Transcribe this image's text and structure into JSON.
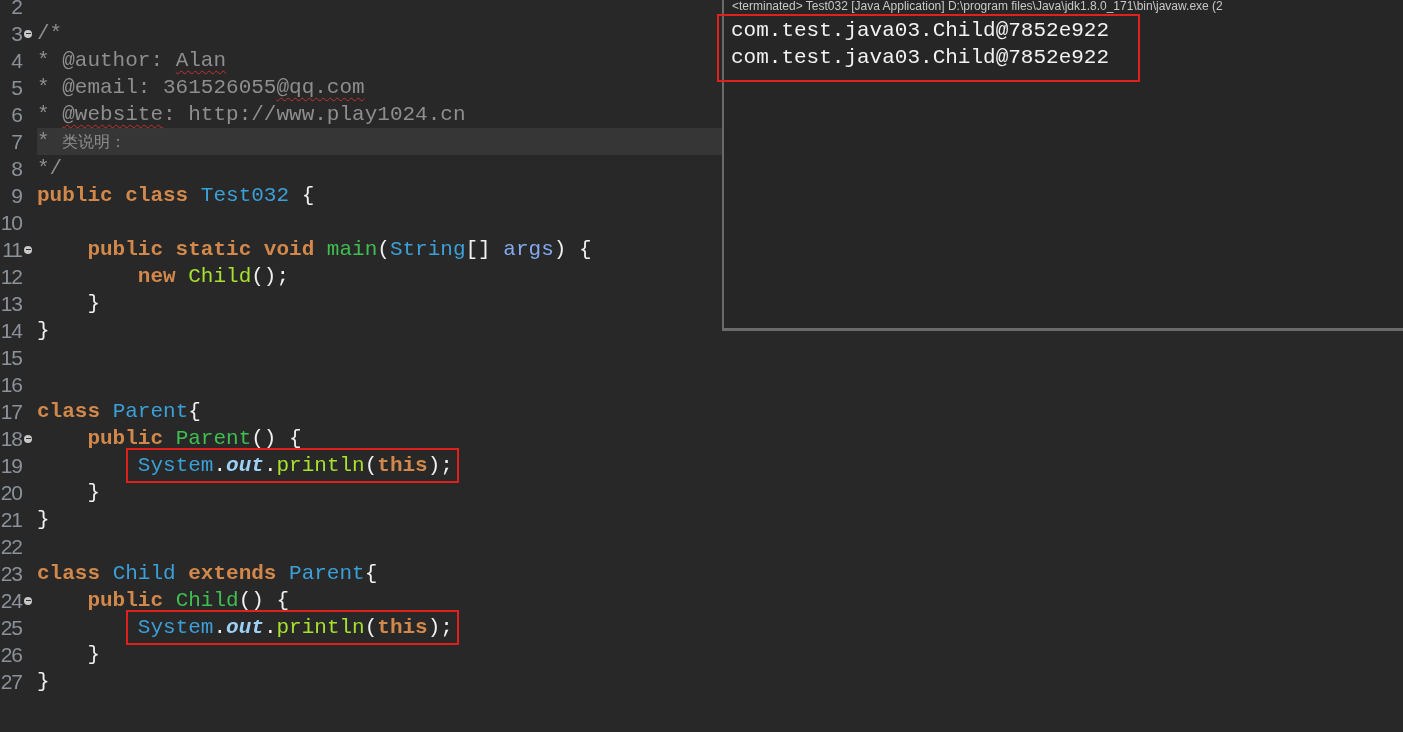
{
  "editor": {
    "lines": [
      {
        "number": "2",
        "current": false,
        "foldable": false
      },
      {
        "number": "3",
        "current": false,
        "foldable": true,
        "tokens": [
          {
            "kind": "comment",
            "text": "/*"
          }
        ]
      },
      {
        "number": "4",
        "current": false,
        "foldable": false,
        "tokens": [
          {
            "kind": "comment",
            "text": "* @author: "
          },
          {
            "kind": "comment",
            "text": "Alan",
            "misspelled": true
          }
        ]
      },
      {
        "number": "5",
        "current": false,
        "foldable": false,
        "tokens": [
          {
            "kind": "comment",
            "text": "* @email: 361526055"
          },
          {
            "kind": "comment",
            "text": "@qq.com",
            "misspelled": true
          }
        ]
      },
      {
        "number": "6",
        "current": false,
        "foldable": false,
        "tokens": [
          {
            "kind": "comment",
            "text": "* "
          },
          {
            "kind": "comment",
            "text": "@website",
            "misspelled": true
          },
          {
            "kind": "comment",
            "text": ": http://www.play1024.cn"
          }
        ]
      },
      {
        "number": "7",
        "current": true,
        "foldable": false,
        "tokens": [
          {
            "kind": "comment",
            "text": "* "
          },
          {
            "kind": "cjk",
            "text": "类说明："
          }
        ]
      },
      {
        "number": "8",
        "current": false,
        "foldable": false,
        "tokens": [
          {
            "kind": "comment",
            "text": "*/"
          }
        ]
      },
      {
        "number": "9",
        "current": false,
        "foldable": false,
        "tokens": [
          {
            "kind": "keyword",
            "text": "public class "
          },
          {
            "kind": "type",
            "text": "Test032"
          },
          {
            "kind": "plain",
            "text": " {"
          }
        ]
      },
      {
        "number": "10",
        "current": false,
        "foldable": false
      },
      {
        "number": "11",
        "current": false,
        "foldable": true,
        "tokens": [
          {
            "kind": "keyword",
            "text": "    public static void "
          },
          {
            "kind": "method",
            "text": "main"
          },
          {
            "kind": "plain",
            "text": "("
          },
          {
            "kind": "type",
            "text": "String"
          },
          {
            "kind": "plain",
            "text": "[] "
          },
          {
            "kind": "param",
            "text": "args"
          },
          {
            "kind": "plain",
            "text": ") {"
          }
        ]
      },
      {
        "number": "12",
        "current": false,
        "foldable": false,
        "tokens": [
          {
            "kind": "keyword",
            "text": "        new "
          },
          {
            "kind": "call",
            "text": "Child"
          },
          {
            "kind": "plain",
            "text": "();"
          }
        ]
      },
      {
        "number": "13",
        "current": false,
        "foldable": false,
        "tokens": [
          {
            "kind": "plain",
            "text": "    }"
          }
        ]
      },
      {
        "number": "14",
        "current": false,
        "foldable": false,
        "tokens": [
          {
            "kind": "plain",
            "text": "}"
          }
        ]
      },
      {
        "number": "15",
        "current": false,
        "foldable": false
      },
      {
        "number": "16",
        "current": false,
        "foldable": false
      },
      {
        "number": "17",
        "current": false,
        "foldable": false,
        "tokens": [
          {
            "kind": "keyword",
            "text": "class "
          },
          {
            "kind": "type",
            "text": "Parent"
          },
          {
            "kind": "plain",
            "text": "{"
          }
        ]
      },
      {
        "number": "18",
        "current": false,
        "foldable": true,
        "tokens": [
          {
            "kind": "keyword",
            "text": "    public "
          },
          {
            "kind": "method",
            "text": "Parent"
          },
          {
            "kind": "plain",
            "text": "() {"
          }
        ]
      },
      {
        "number": "19",
        "current": false,
        "foldable": false,
        "boxed": true,
        "tokens": [
          {
            "kind": "type",
            "text": "        System"
          },
          {
            "kind": "plain",
            "text": "."
          },
          {
            "kind": "field",
            "text": "out"
          },
          {
            "kind": "plain",
            "text": "."
          },
          {
            "kind": "call",
            "text": "println"
          },
          {
            "kind": "plain",
            "text": "("
          },
          {
            "kind": "keyword",
            "text": "this"
          },
          {
            "kind": "plain",
            "text": ");"
          }
        ]
      },
      {
        "number": "20",
        "current": false,
        "foldable": false,
        "tokens": [
          {
            "kind": "plain",
            "text": "    }"
          }
        ]
      },
      {
        "number": "21",
        "current": false,
        "foldable": false,
        "tokens": [
          {
            "kind": "plain",
            "text": "}"
          }
        ]
      },
      {
        "number": "22",
        "current": false,
        "foldable": false
      },
      {
        "number": "23",
        "current": false,
        "foldable": false,
        "tokens": [
          {
            "kind": "keyword",
            "text": "class "
          },
          {
            "kind": "type",
            "text": "Child"
          },
          {
            "kind": "keyword",
            "text": " extends "
          },
          {
            "kind": "type",
            "text": "Parent"
          },
          {
            "kind": "plain",
            "text": "{"
          }
        ]
      },
      {
        "number": "24",
        "current": false,
        "foldable": true,
        "tokens": [
          {
            "kind": "keyword",
            "text": "    public "
          },
          {
            "kind": "method",
            "text": "Child"
          },
          {
            "kind": "plain",
            "text": "() {"
          }
        ]
      },
      {
        "number": "25",
        "current": false,
        "foldable": false,
        "boxed": true,
        "tokens": [
          {
            "kind": "type",
            "text": "        System"
          },
          {
            "kind": "plain",
            "text": "."
          },
          {
            "kind": "field",
            "text": "out"
          },
          {
            "kind": "plain",
            "text": "."
          },
          {
            "kind": "call",
            "text": "println"
          },
          {
            "kind": "plain",
            "text": "("
          },
          {
            "kind": "keyword",
            "text": "this"
          },
          {
            "kind": "plain",
            "text": ");"
          }
        ]
      },
      {
        "number": "26",
        "current": false,
        "foldable": false,
        "tokens": [
          {
            "kind": "plain",
            "text": "    }"
          }
        ]
      },
      {
        "number": "27",
        "current": false,
        "foldable": false,
        "tokens": [
          {
            "kind": "plain",
            "text": "}"
          }
        ]
      }
    ]
  },
  "console": {
    "header": "<terminated> Test032 [Java Application] D:\\program files\\Java\\jdk1.8.0_171\\bin\\javaw.exe (2",
    "boxed": true,
    "output": [
      "com.test.java03.Child@7852e922",
      "com.test.java03.Child@7852e922"
    ]
  }
}
